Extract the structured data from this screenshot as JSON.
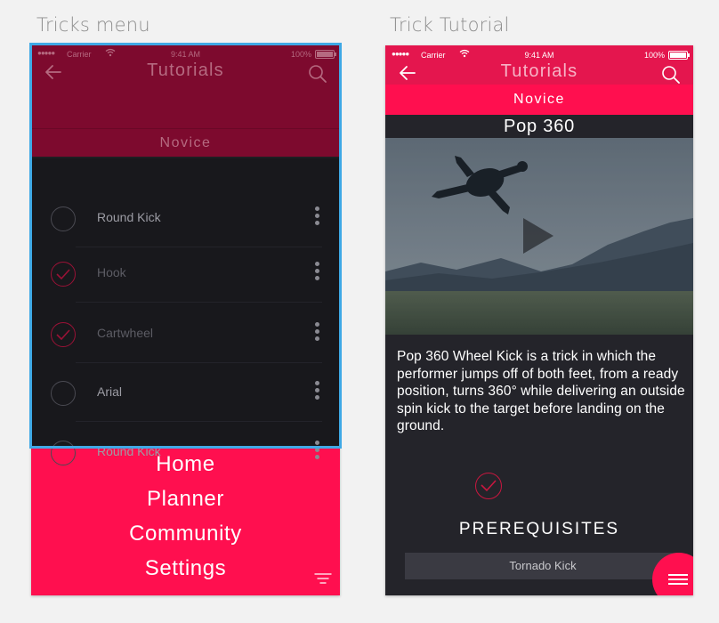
{
  "labels": {
    "left_artboard": "Tricks menu",
    "right_artboard": "Trick Tutorial"
  },
  "status_bar": {
    "dots": "●●●●●",
    "carrier": "Carrier",
    "time": "9:41 AM",
    "battery": "100%"
  },
  "left": {
    "nav_title": "Tutorials",
    "level": "Novice",
    "tricks": [
      {
        "name": "Round Kick",
        "completed": false
      },
      {
        "name": "Hook",
        "completed": true
      },
      {
        "name": "Cartwheel",
        "completed": true
      },
      {
        "name": "Arial",
        "completed": false
      },
      {
        "name": "Round Kick",
        "completed": false
      }
    ],
    "menu": [
      "Home",
      "Planner",
      "Community",
      "Settings"
    ]
  },
  "right": {
    "nav_title": "Tutorials",
    "level": "Novice",
    "trick_title": "Pop 360",
    "description": "Pop 360 Wheel Kick is a trick in which the performer jumps off of both feet, from a ready position, turns 360° while delivering an outside spin kick to the target before landing on the ground.",
    "prerequisites_heading": "PREREQUISITES",
    "prerequisites": [
      "Tornado Kick"
    ]
  },
  "colors": {
    "accent": "#ff0f4f",
    "accent_dark": "#7d0a2e",
    "screen_dark": "#18181c",
    "selection": "#3fa9e6"
  }
}
